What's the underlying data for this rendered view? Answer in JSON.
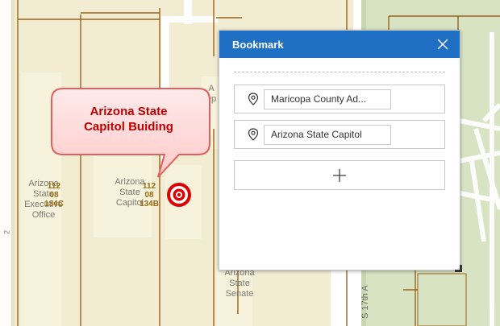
{
  "map": {
    "callout_text": "Arizona State Capitol Buiding",
    "labels": {
      "executive_office": "Arizona State Executive Office",
      "state_capitol": "Arizona State Capitol",
      "state_senate": "Arizona State Senate",
      "partial_building": "A ep",
      "street_17th": "S 17th A",
      "parcel_1": "112 08 134C",
      "parcel_2": "112 08 134B",
      "left_digit": "2"
    },
    "colors": {
      "background": "#f2ecd3",
      "parcel_line": "#9b6418",
      "callout_fill": "#ffd9d9",
      "callout_text": "#c00000",
      "target": "#e00000"
    }
  },
  "bookmark_panel": {
    "title": "Bookmark",
    "close_icon": "close-icon",
    "items": [
      {
        "icon": "map-pin-icon",
        "name": "Maricopa County Ad..."
      },
      {
        "icon": "map-pin-icon",
        "name": "Arizona State Capitol"
      }
    ],
    "add_icon": "plus-icon",
    "header_color": "#1f6fc5"
  }
}
